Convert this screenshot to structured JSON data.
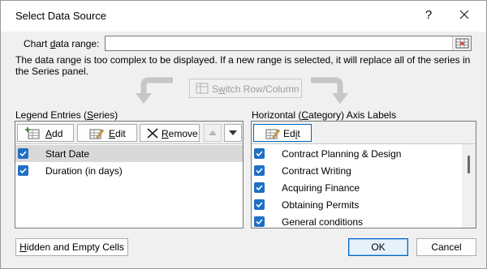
{
  "dialog": {
    "title": "Select Data Source",
    "help_label": "?",
    "close_icon": "close-icon"
  },
  "range": {
    "label_pre": "Chart ",
    "label_ul": "d",
    "label_post": "ata range:",
    "value": "",
    "collapse_icon": "range-collapse-icon",
    "message": "The data range is too complex to be displayed. If a new range is selected, it will replace all of the series in the Series panel."
  },
  "switch": {
    "label_pre": "S",
    "label_ul": "w",
    "label_post": "itch Row/Column",
    "enabled": false
  },
  "legend": {
    "title_pre": "Legend Entries (",
    "title_ul": "S",
    "title_post": "eries)",
    "add_ul": "A",
    "add_post": "dd",
    "edit_ul": "E",
    "edit_post": "dit",
    "remove_ul": "R",
    "remove_post": "emove",
    "move_up_icon": "move-up-icon",
    "move_down_icon": "move-down-icon",
    "items": [
      {
        "label": "Start Date",
        "checked": true,
        "selected": true
      },
      {
        "label": "Duration (in days)",
        "checked": true,
        "selected": false
      }
    ]
  },
  "axis": {
    "title_pre": "Horizontal (",
    "title_ul": "C",
    "title_post": "ategory) Axis Labels",
    "edit_pre": "Ed",
    "edit_ul": "i",
    "edit_post": "t",
    "items": [
      {
        "label": "Contract Planning & Design",
        "checked": true
      },
      {
        "label": "Contract Writing",
        "checked": true
      },
      {
        "label": "Acquiring Finance",
        "checked": true
      },
      {
        "label": "Obtaining Permits",
        "checked": true
      },
      {
        "label": "General conditions",
        "checked": true
      }
    ]
  },
  "footer": {
    "hidden_ul": "H",
    "hidden_post": "idden and Empty Cells",
    "ok_label": "OK",
    "cancel_label": "Cancel"
  },
  "colors": {
    "checkbox": "#1f6fc5",
    "primary_border": "#0067c0",
    "dialog_bg": "#f0f0f0"
  }
}
